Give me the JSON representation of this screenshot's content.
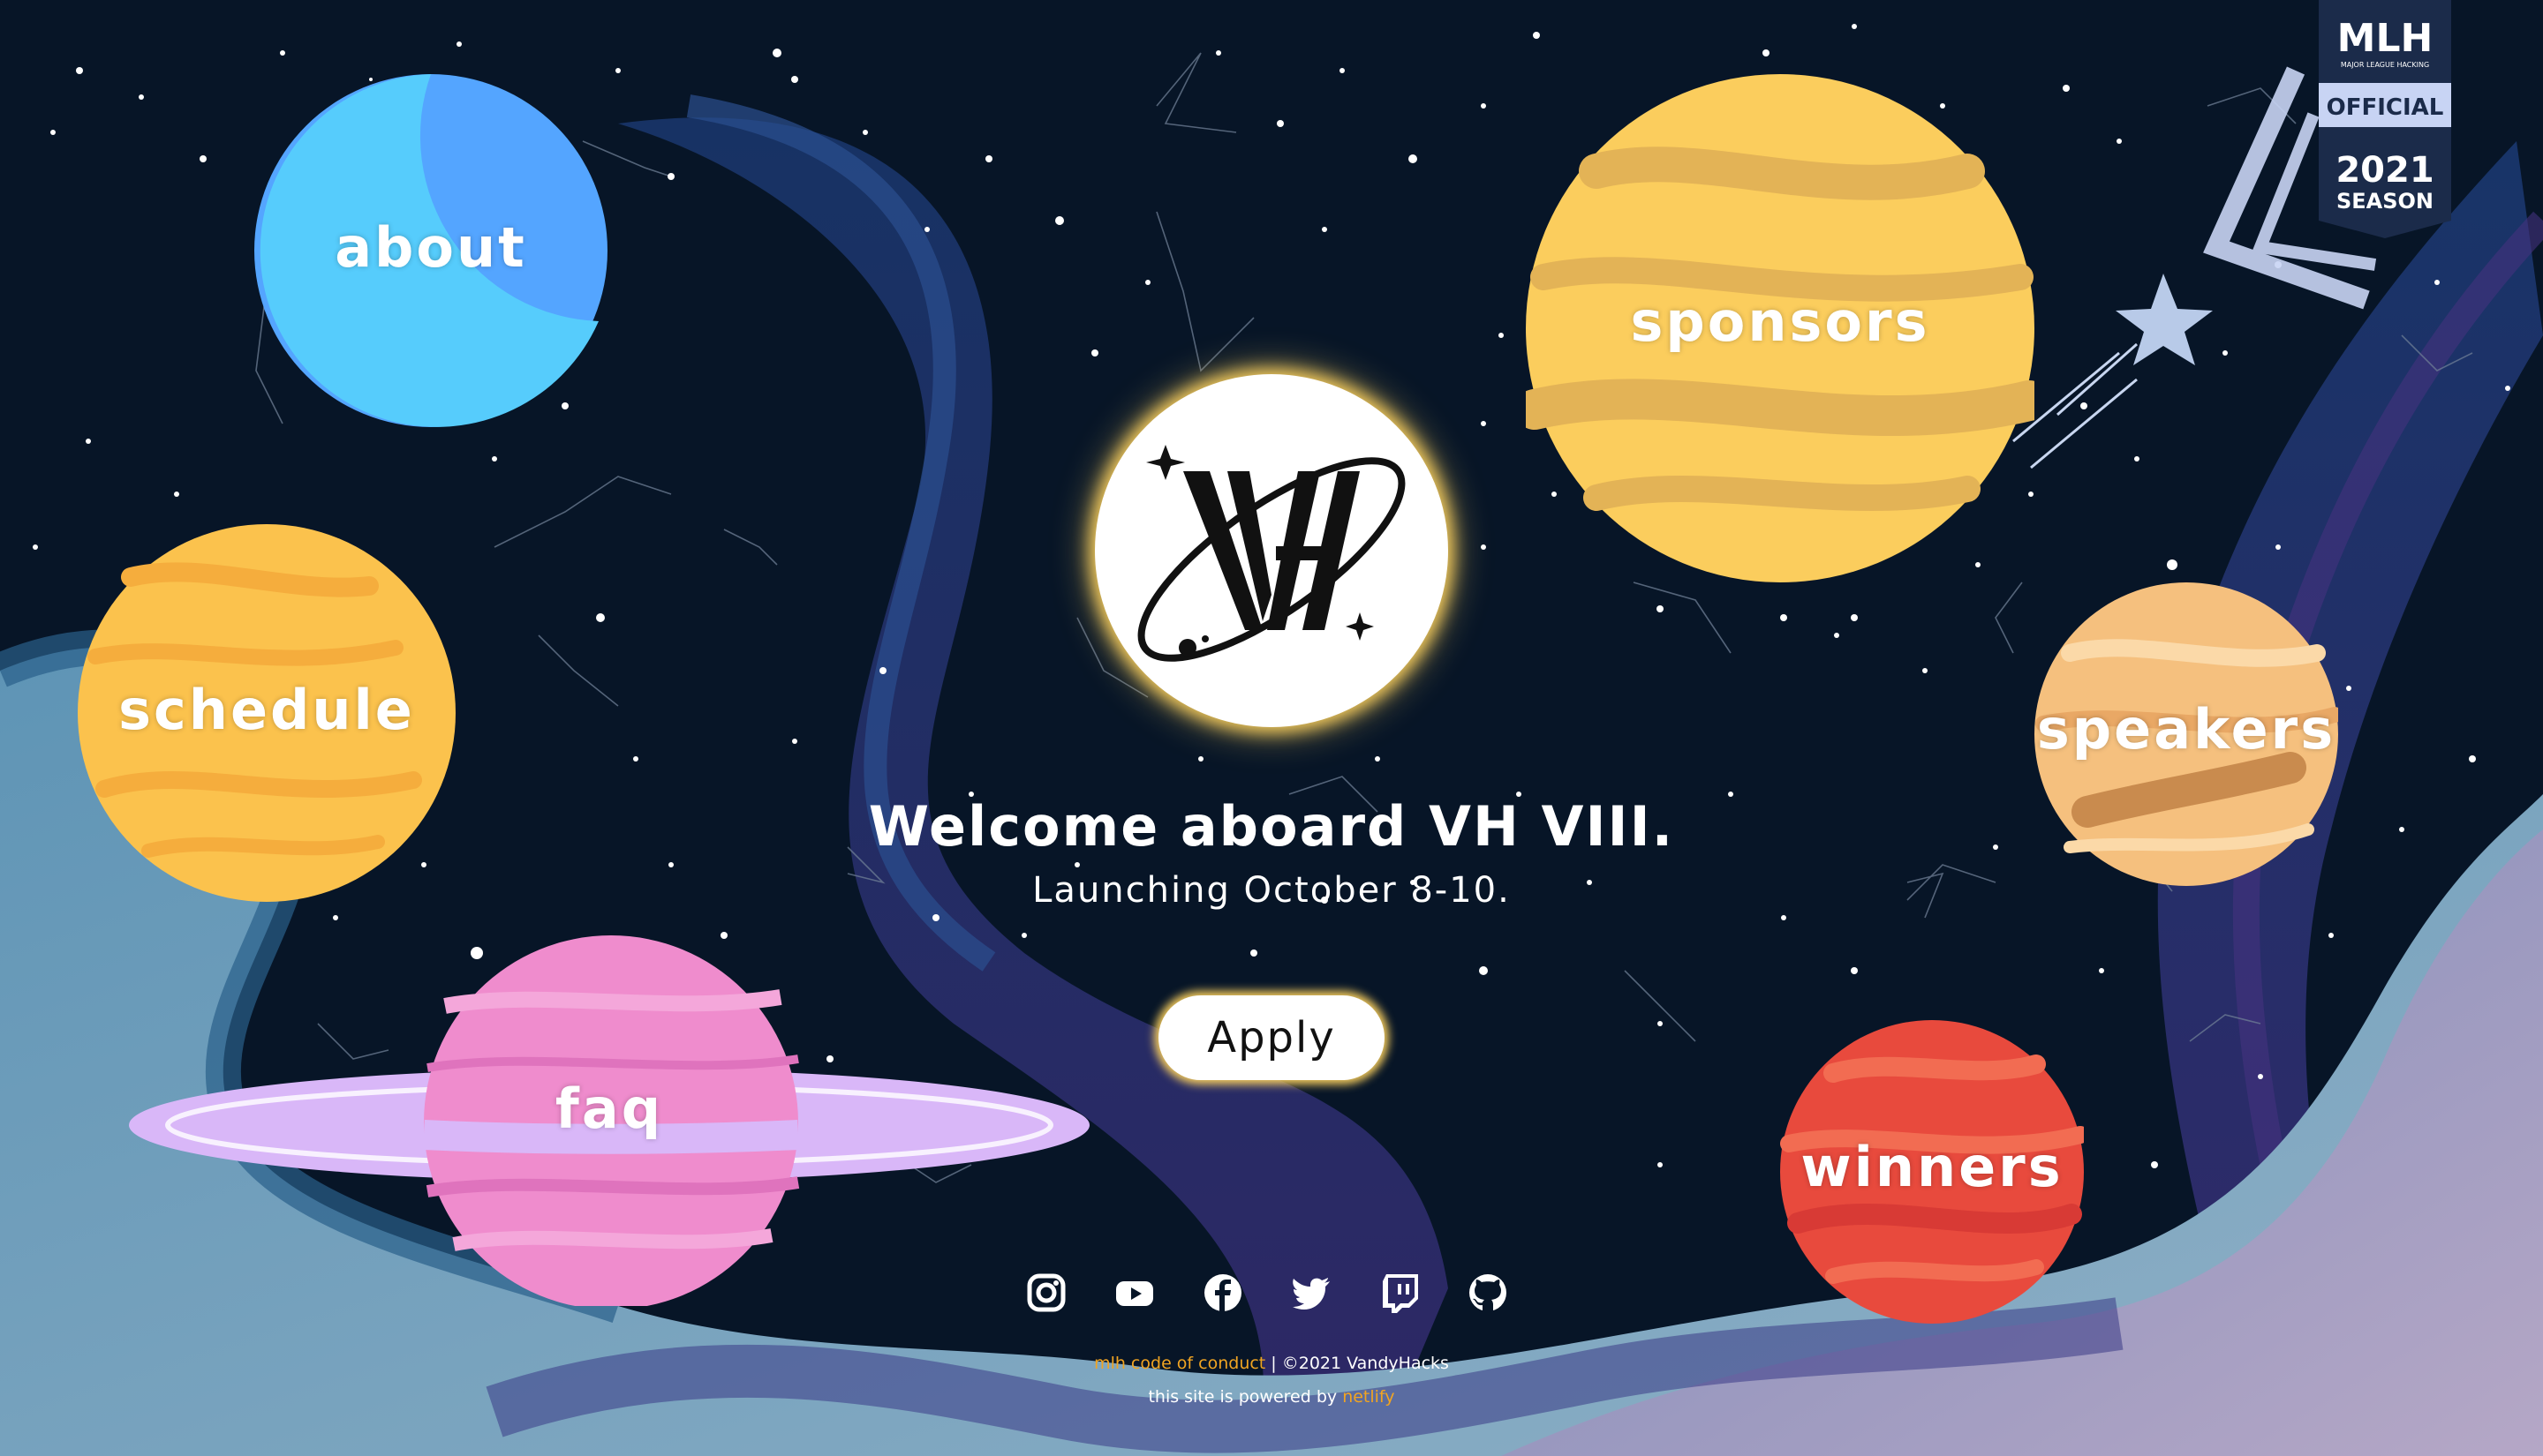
{
  "nav": {
    "about": "about",
    "schedule": "schedule",
    "faq": "faq",
    "sponsors": "sponsors",
    "speakers": "speakers",
    "winners": "winners"
  },
  "hero": {
    "title": "Welcome aboard VH VIII.",
    "subtitle": "Launching October 8-10.",
    "apply_label": "Apply"
  },
  "logo": {
    "text": "VH"
  },
  "socials": [
    "instagram-icon",
    "youtube-icon",
    "facebook-icon",
    "twitter-icon",
    "twitch-icon",
    "github-icon"
  ],
  "footer": {
    "conduct_link": "mlh code of conduct",
    "separator": " | ",
    "copyright": "©2021 VandyHacks",
    "powered_prefix": "this site is powered by ",
    "netlify_link": "netlify"
  },
  "mlh_badge": {
    "brand": "MLH",
    "tagline": "MAJOR LEAGUE HACKING",
    "official": "OFFICIAL",
    "year": "2021",
    "season": "SEASON"
  },
  "colors": {
    "background": "#071527",
    "accent_gold": "#f5cc5d",
    "link_orange": "#f0a422",
    "about_planet": "#54c6fb",
    "schedule_planet": "#fbc24d",
    "faq_planet": "#ef8ccd",
    "sponsors_planet": "#fbcd5d",
    "speakers_planet": "#f5c07e",
    "winners_planet": "#e84a3d",
    "mlh_navy": "#1b2b4a"
  }
}
